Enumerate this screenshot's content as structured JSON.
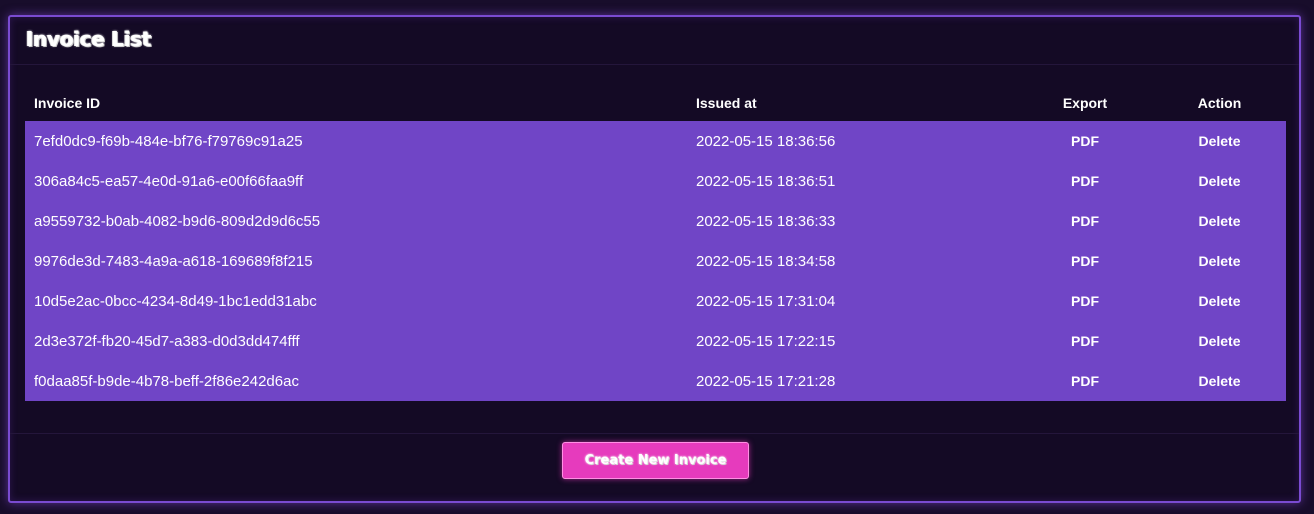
{
  "panel": {
    "title": "Invoice List"
  },
  "table": {
    "headers": {
      "invoice_id": "Invoice ID",
      "issued_at": "Issued at",
      "export": "Export",
      "action": "Action"
    },
    "rows": [
      {
        "invoice_id": "7efd0dc9-f69b-484e-bf76-f79769c91a25",
        "issued_at": "2022-05-15 18:36:56",
        "export": "PDF",
        "action": "Delete"
      },
      {
        "invoice_id": "306a84c5-ea57-4e0d-91a6-e00f66faa9ff",
        "issued_at": "2022-05-15 18:36:51",
        "export": "PDF",
        "action": "Delete"
      },
      {
        "invoice_id": "a9559732-b0ab-4082-b9d6-809d2d9d6c55",
        "issued_at": "2022-05-15 18:36:33",
        "export": "PDF",
        "action": "Delete"
      },
      {
        "invoice_id": "9976de3d-7483-4a9a-a618-169689f8f215",
        "issued_at": "2022-05-15 18:34:58",
        "export": "PDF",
        "action": "Delete"
      },
      {
        "invoice_id": "10d5e2ac-0bcc-4234-8d49-1bc1edd31abc",
        "issued_at": "2022-05-15 17:31:04",
        "export": "PDF",
        "action": "Delete"
      },
      {
        "invoice_id": "2d3e372f-fb20-45d7-a383-d0d3dd474fff",
        "issued_at": "2022-05-15 17:22:15",
        "export": "PDF",
        "action": "Delete"
      },
      {
        "invoice_id": "f0daa85f-b9de-4b78-beff-2f86e242d6ac",
        "issued_at": "2022-05-15 17:21:28",
        "export": "PDF",
        "action": "Delete"
      }
    ]
  },
  "footer": {
    "create_button_label": "Create New Invoice"
  },
  "colors": {
    "page_background": "#180d2b",
    "panel_border": "#7a4bd1",
    "row_background": "#7045c6",
    "button_background": "#e63bbd"
  }
}
